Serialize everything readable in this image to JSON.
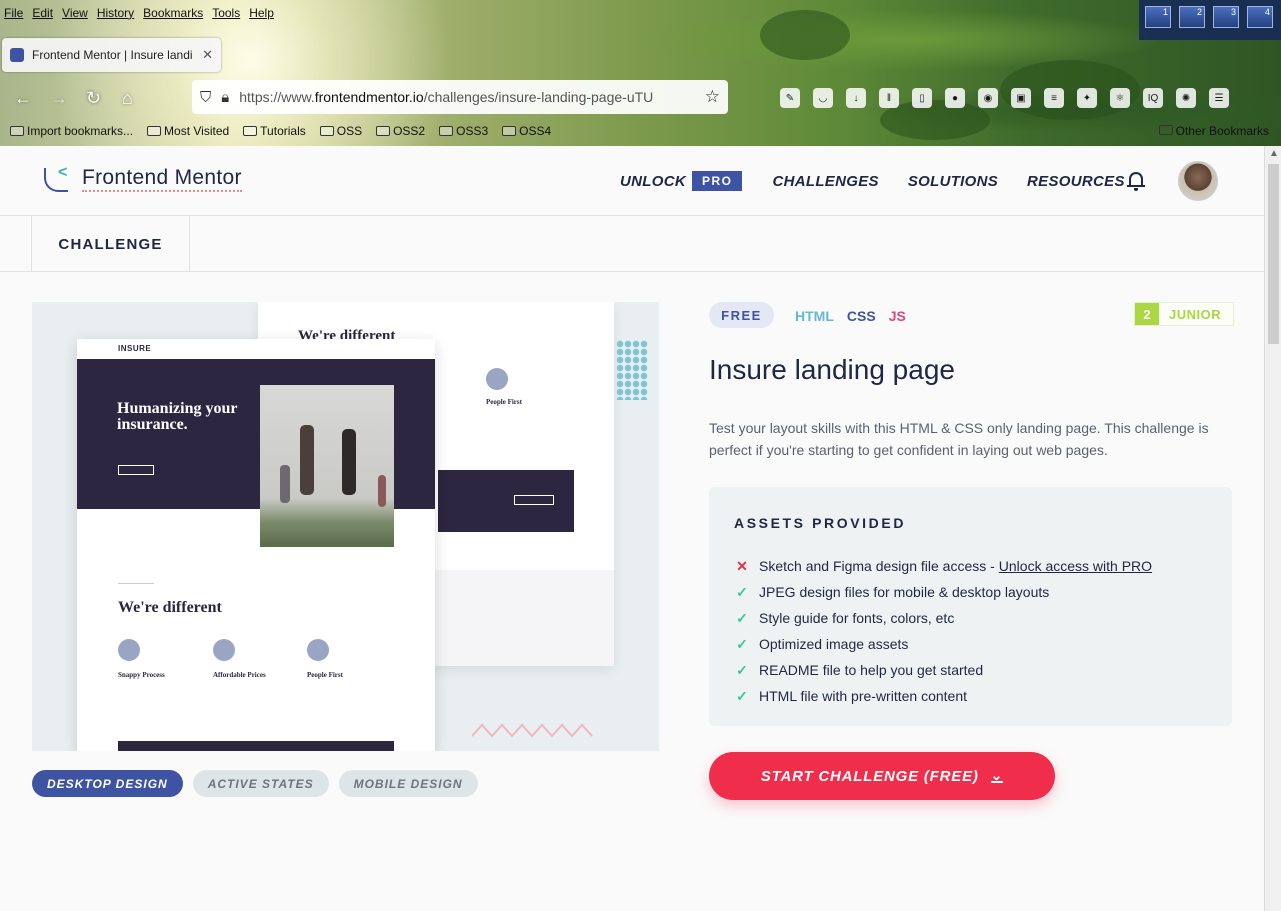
{
  "browser": {
    "menu": [
      "File",
      "Edit",
      "View",
      "History",
      "Bookmarks",
      "Tools",
      "Help"
    ],
    "desktops": [
      "1",
      "2",
      "3",
      "4"
    ],
    "tab_title": "Frontend Mentor | Insure landi",
    "url_prefix": "https://www.",
    "url_domain": "frontendmentor.io",
    "url_path": "/challenges/insure-landing-page-uTU",
    "toolbar_icons": [
      "eyedropper-icon",
      "pocket-icon",
      "download-icon",
      "library-icon",
      "sidebar-icon",
      "twd-icon",
      "globe-icon",
      "picture-icon",
      "notes-icon",
      "puzzle-icon",
      "react-icon",
      "iq-icon",
      "color-icon",
      "menu-icon"
    ],
    "bookmarks": [
      "Import bookmarks...",
      "Most Visited",
      "Tutorials",
      "OSS",
      "OSS2",
      "OSS3",
      "OSS4"
    ],
    "other_bookmarks": "Other Bookmarks"
  },
  "header": {
    "logo_text": "Frontend Mentor",
    "nav": {
      "unlock": "UNLOCK",
      "pro_badge": "PRO",
      "challenges": "CHALLENGES",
      "solutions": "SOLUTIONS",
      "resources": "RESOURCES"
    }
  },
  "subnav": {
    "tab": "CHALLENGE"
  },
  "preview": {
    "back_heading": "We're different",
    "back_feature": "People First",
    "front_logo": "INSURE",
    "front_hero": "Humanizing your insurance.",
    "front_heading": "We're different",
    "features": [
      "Snappy Process",
      "Affordable Prices",
      "People First"
    ]
  },
  "design_tags": [
    {
      "label": "DESKTOP DESIGN",
      "active": true
    },
    {
      "label": "ACTIVE STATES",
      "active": false
    },
    {
      "label": "MOBILE DESIGN",
      "active": false
    }
  ],
  "challenge": {
    "price": "FREE",
    "langs": [
      "HTML",
      "CSS",
      "JS"
    ],
    "level_number": "2",
    "level_name": "JUNIOR",
    "title": "Insure landing page",
    "description": "Test your layout skills with this HTML & CSS only landing page. This challenge is perfect if you're starting to get confident in laying out web pages."
  },
  "assets": {
    "title": "ASSETS PROVIDED",
    "items": [
      {
        "text": "Sketch and Figma design file access -",
        "link": "Unlock access with PRO",
        "included": false
      },
      {
        "text": "JPEG design files for mobile & desktop layouts",
        "included": true
      },
      {
        "text": "Style guide for fonts, colors, etc",
        "included": true
      },
      {
        "text": "Optimized image assets",
        "included": true
      },
      {
        "text": "README file to help you get started",
        "included": true
      },
      {
        "text": "HTML file with pre-written content",
        "included": true
      }
    ]
  },
  "cta": {
    "label": "START CHALLENGE (FREE)"
  },
  "colors": {
    "brand_blue": "#3e54a3",
    "cta_red": "#f02d4b",
    "junior_green": "#aad742",
    "check_green": "#3ac89a"
  }
}
